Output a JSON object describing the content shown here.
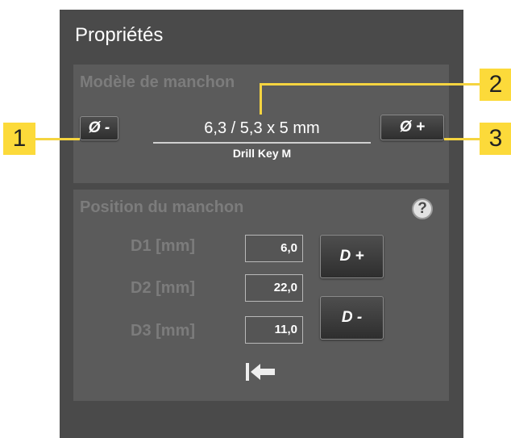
{
  "panel": {
    "title": "Propriétés"
  },
  "sleeve_model": {
    "label": "Modèle de manchon",
    "decrease_button": "Ø -",
    "increase_button": "Ø +",
    "value": "6,3 / 5,3 x 5 mm",
    "name": "Drill Key M"
  },
  "sleeve_position": {
    "label": "Position du manchon",
    "help": "?",
    "rows": [
      {
        "label": "D1 [mm]",
        "value": "6,0"
      },
      {
        "label": "D2 [mm]",
        "value": "22,0"
      },
      {
        "label": "D3 [mm]",
        "value": "11,0"
      }
    ],
    "increase_button": "D +",
    "decrease_button": "D -",
    "reset_icon": "arrow-to-left-bar-icon"
  },
  "callouts": [
    "1",
    "2",
    "3"
  ],
  "colors": {
    "panel": "#4a4a4a",
    "group": "#5b5b5b",
    "callout": "#fcda3a",
    "muted_label": "#7c7c7c"
  }
}
